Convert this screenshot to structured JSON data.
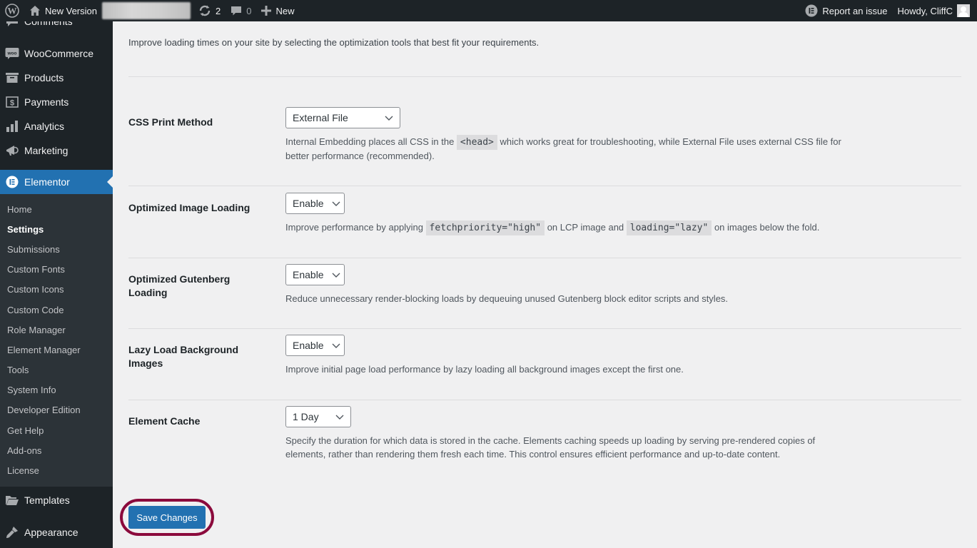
{
  "adminbar": {
    "wp_logo": "wordpress-logo-icon",
    "site_name": "New Version",
    "updates_count": "2",
    "comments_count": "0",
    "new_label": "New",
    "report_issue": "Report an issue",
    "howdy": "Howdy, CliffC"
  },
  "sidebar": {
    "top_items": [
      {
        "label": "Comments",
        "icon": "comments-icon"
      },
      {
        "label": "WooCommerce",
        "icon": "woocommerce-icon"
      },
      {
        "label": "Products",
        "icon": "products-icon"
      },
      {
        "label": "Payments",
        "icon": "payments-icon"
      },
      {
        "label": "Analytics",
        "icon": "analytics-icon"
      },
      {
        "label": "Marketing",
        "icon": "marketing-icon"
      },
      {
        "label": "Elementor",
        "icon": "elementor-icon"
      }
    ],
    "submenu": [
      {
        "label": "Home"
      },
      {
        "label": "Settings",
        "active": true
      },
      {
        "label": "Submissions"
      },
      {
        "label": "Custom Fonts"
      },
      {
        "label": "Custom Icons"
      },
      {
        "label": "Custom Code"
      },
      {
        "label": "Role Manager"
      },
      {
        "label": "Element Manager"
      },
      {
        "label": "Tools"
      },
      {
        "label": "System Info"
      },
      {
        "label": "Developer Edition"
      },
      {
        "label": "Get Help"
      },
      {
        "label": "Add-ons"
      },
      {
        "label": "License"
      }
    ],
    "bottom_items": [
      {
        "label": "Templates",
        "icon": "templates-icon"
      },
      {
        "label": "Appearance",
        "icon": "appearance-icon"
      }
    ]
  },
  "main": {
    "intro": "Improve loading times on your site by selecting the optimization tools that best fit your requirements.",
    "settings": [
      {
        "label": "CSS Print Method",
        "value": "External File",
        "desc_parts": [
          "Internal Embedding places all CSS in the ",
          "<head>",
          " which works great for troubleshooting, while External File uses external CSS file for better performance (recommended)."
        ]
      },
      {
        "label": "Optimized Image Loading",
        "value": "Enable",
        "desc_parts": [
          "Improve performance by applying ",
          "fetchpriority=\"high\"",
          " on LCP image and ",
          "loading=\"lazy\"",
          " on images below the fold."
        ]
      },
      {
        "label": "Optimized Gutenberg Loading",
        "value": "Enable",
        "desc": "Reduce unnecessary render-blocking loads by dequeuing unused Gutenberg block editor scripts and styles."
      },
      {
        "label": "Lazy Load Background Images",
        "value": "Enable",
        "desc": "Improve initial page load performance by lazy loading all background images except the first one."
      },
      {
        "label": "Element Cache",
        "value": "1 Day",
        "desc": "Specify the duration for which data is stored in the cache. Elements caching speeds up loading by serving pre-rendered copies of elements, rather than rendering them fresh each time. This control ensures efficient performance and up-to-date content."
      }
    ],
    "save_label": "Save Changes",
    "highlight_color": "#8b0a3c",
    "accent_color": "#2271b1"
  }
}
